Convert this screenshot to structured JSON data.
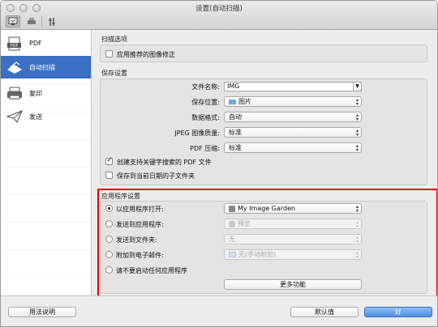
{
  "window": {
    "title": "设置(自动扫描)"
  },
  "toolbar": {
    "icons": [
      "scan-from-computer-icon",
      "scan-from-panel-icon",
      "general-settings-icon"
    ]
  },
  "sidebar": {
    "items": [
      {
        "label": "PDF",
        "icon": "pdf-icon",
        "selected": false
      },
      {
        "label": "自动扫描",
        "icon": "auto-scan-icon",
        "selected": true
      },
      {
        "label": "复印",
        "icon": "copy-icon",
        "selected": false
      },
      {
        "label": "发送",
        "icon": "send-icon",
        "selected": false
      }
    ]
  },
  "scan_options": {
    "title": "扫描选项",
    "apply_correction": {
      "label": "应用推荐的图像修正",
      "checked": false
    }
  },
  "save_settings": {
    "title": "保存设置",
    "file_name": {
      "label": "文件名称:",
      "value": "IMG"
    },
    "save_in": {
      "label": "保存位置:",
      "value": "图片"
    },
    "data_format": {
      "label": "数据格式:",
      "value": "自动"
    },
    "jpeg_quality": {
      "label": "JPEG 图像质量:",
      "value": "标准"
    },
    "pdf_compression": {
      "label": "PDF 压缩:",
      "value": "标准"
    },
    "create_searchable_pdf": {
      "label": "创建支持关键字搜索的 PDF 文件",
      "checked": true
    },
    "save_to_subfolder": {
      "label": "保存到当前日期的子文件夹",
      "checked": false
    }
  },
  "app_settings": {
    "title": "应用程序设置",
    "options": [
      {
        "label": "以应用程序打开:",
        "selected": true,
        "value": "My Image Garden",
        "enabled": true
      },
      {
        "label": "发送到应用程序:",
        "selected": false,
        "value": "预览",
        "enabled": false
      },
      {
        "label": "发送到文件夹:",
        "selected": false,
        "value": "无",
        "enabled": false
      },
      {
        "label": "附加到电子邮件:",
        "selected": false,
        "value": "无(手动附加)",
        "enabled": false
      },
      {
        "label": "请不要启动任何应用程序",
        "selected": false
      }
    ],
    "more_functions": "更多功能"
  },
  "footer": {
    "instructions": "用法说明",
    "defaults": "默认值",
    "ok": "好"
  },
  "colors": {
    "selection": "#3b70c4",
    "highlight_box": "#e00000",
    "default_button": "#4d8fe3"
  }
}
